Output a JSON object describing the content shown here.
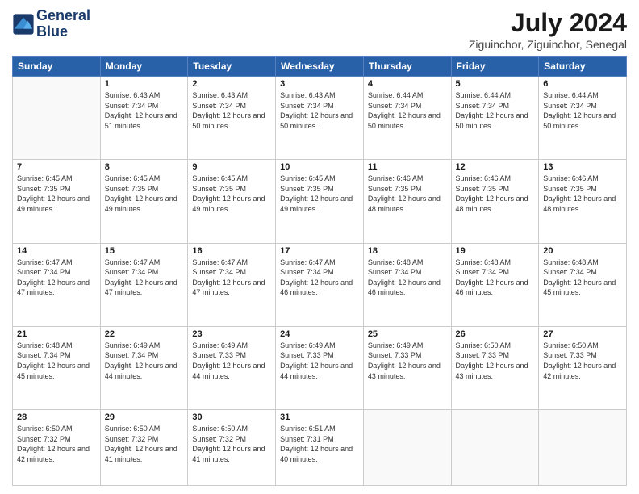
{
  "header": {
    "logo_line1": "General",
    "logo_line2": "Blue",
    "month_title": "July 2024",
    "subtitle": "Ziguinchor, Ziguinchor, Senegal"
  },
  "days_of_week": [
    "Sunday",
    "Monday",
    "Tuesday",
    "Wednesday",
    "Thursday",
    "Friday",
    "Saturday"
  ],
  "weeks": [
    [
      {
        "day": "",
        "sunrise": "",
        "sunset": "",
        "daylight": ""
      },
      {
        "day": "1",
        "sunrise": "Sunrise: 6:43 AM",
        "sunset": "Sunset: 7:34 PM",
        "daylight": "Daylight: 12 hours and 51 minutes."
      },
      {
        "day": "2",
        "sunrise": "Sunrise: 6:43 AM",
        "sunset": "Sunset: 7:34 PM",
        "daylight": "Daylight: 12 hours and 50 minutes."
      },
      {
        "day": "3",
        "sunrise": "Sunrise: 6:43 AM",
        "sunset": "Sunset: 7:34 PM",
        "daylight": "Daylight: 12 hours and 50 minutes."
      },
      {
        "day": "4",
        "sunrise": "Sunrise: 6:44 AM",
        "sunset": "Sunset: 7:34 PM",
        "daylight": "Daylight: 12 hours and 50 minutes."
      },
      {
        "day": "5",
        "sunrise": "Sunrise: 6:44 AM",
        "sunset": "Sunset: 7:34 PM",
        "daylight": "Daylight: 12 hours and 50 minutes."
      },
      {
        "day": "6",
        "sunrise": "Sunrise: 6:44 AM",
        "sunset": "Sunset: 7:34 PM",
        "daylight": "Daylight: 12 hours and 50 minutes."
      }
    ],
    [
      {
        "day": "7",
        "sunrise": "Sunrise: 6:45 AM",
        "sunset": "Sunset: 7:35 PM",
        "daylight": "Daylight: 12 hours and 49 minutes."
      },
      {
        "day": "8",
        "sunrise": "Sunrise: 6:45 AM",
        "sunset": "Sunset: 7:35 PM",
        "daylight": "Daylight: 12 hours and 49 minutes."
      },
      {
        "day": "9",
        "sunrise": "Sunrise: 6:45 AM",
        "sunset": "Sunset: 7:35 PM",
        "daylight": "Daylight: 12 hours and 49 minutes."
      },
      {
        "day": "10",
        "sunrise": "Sunrise: 6:45 AM",
        "sunset": "Sunset: 7:35 PM",
        "daylight": "Daylight: 12 hours and 49 minutes."
      },
      {
        "day": "11",
        "sunrise": "Sunrise: 6:46 AM",
        "sunset": "Sunset: 7:35 PM",
        "daylight": "Daylight: 12 hours and 48 minutes."
      },
      {
        "day": "12",
        "sunrise": "Sunrise: 6:46 AM",
        "sunset": "Sunset: 7:35 PM",
        "daylight": "Daylight: 12 hours and 48 minutes."
      },
      {
        "day": "13",
        "sunrise": "Sunrise: 6:46 AM",
        "sunset": "Sunset: 7:35 PM",
        "daylight": "Daylight: 12 hours and 48 minutes."
      }
    ],
    [
      {
        "day": "14",
        "sunrise": "Sunrise: 6:47 AM",
        "sunset": "Sunset: 7:34 PM",
        "daylight": "Daylight: 12 hours and 47 minutes."
      },
      {
        "day": "15",
        "sunrise": "Sunrise: 6:47 AM",
        "sunset": "Sunset: 7:34 PM",
        "daylight": "Daylight: 12 hours and 47 minutes."
      },
      {
        "day": "16",
        "sunrise": "Sunrise: 6:47 AM",
        "sunset": "Sunset: 7:34 PM",
        "daylight": "Daylight: 12 hours and 47 minutes."
      },
      {
        "day": "17",
        "sunrise": "Sunrise: 6:47 AM",
        "sunset": "Sunset: 7:34 PM",
        "daylight": "Daylight: 12 hours and 46 minutes."
      },
      {
        "day": "18",
        "sunrise": "Sunrise: 6:48 AM",
        "sunset": "Sunset: 7:34 PM",
        "daylight": "Daylight: 12 hours and 46 minutes."
      },
      {
        "day": "19",
        "sunrise": "Sunrise: 6:48 AM",
        "sunset": "Sunset: 7:34 PM",
        "daylight": "Daylight: 12 hours and 46 minutes."
      },
      {
        "day": "20",
        "sunrise": "Sunrise: 6:48 AM",
        "sunset": "Sunset: 7:34 PM",
        "daylight": "Daylight: 12 hours and 45 minutes."
      }
    ],
    [
      {
        "day": "21",
        "sunrise": "Sunrise: 6:48 AM",
        "sunset": "Sunset: 7:34 PM",
        "daylight": "Daylight: 12 hours and 45 minutes."
      },
      {
        "day": "22",
        "sunrise": "Sunrise: 6:49 AM",
        "sunset": "Sunset: 7:34 PM",
        "daylight": "Daylight: 12 hours and 44 minutes."
      },
      {
        "day": "23",
        "sunrise": "Sunrise: 6:49 AM",
        "sunset": "Sunset: 7:33 PM",
        "daylight": "Daylight: 12 hours and 44 minutes."
      },
      {
        "day": "24",
        "sunrise": "Sunrise: 6:49 AM",
        "sunset": "Sunset: 7:33 PM",
        "daylight": "Daylight: 12 hours and 44 minutes."
      },
      {
        "day": "25",
        "sunrise": "Sunrise: 6:49 AM",
        "sunset": "Sunset: 7:33 PM",
        "daylight": "Daylight: 12 hours and 43 minutes."
      },
      {
        "day": "26",
        "sunrise": "Sunrise: 6:50 AM",
        "sunset": "Sunset: 7:33 PM",
        "daylight": "Daylight: 12 hours and 43 minutes."
      },
      {
        "day": "27",
        "sunrise": "Sunrise: 6:50 AM",
        "sunset": "Sunset: 7:33 PM",
        "daylight": "Daylight: 12 hours and 42 minutes."
      }
    ],
    [
      {
        "day": "28",
        "sunrise": "Sunrise: 6:50 AM",
        "sunset": "Sunset: 7:32 PM",
        "daylight": "Daylight: 12 hours and 42 minutes."
      },
      {
        "day": "29",
        "sunrise": "Sunrise: 6:50 AM",
        "sunset": "Sunset: 7:32 PM",
        "daylight": "Daylight: 12 hours and 41 minutes."
      },
      {
        "day": "30",
        "sunrise": "Sunrise: 6:50 AM",
        "sunset": "Sunset: 7:32 PM",
        "daylight": "Daylight: 12 hours and 41 minutes."
      },
      {
        "day": "31",
        "sunrise": "Sunrise: 6:51 AM",
        "sunset": "Sunset: 7:31 PM",
        "daylight": "Daylight: 12 hours and 40 minutes."
      },
      {
        "day": "",
        "sunrise": "",
        "sunset": "",
        "daylight": ""
      },
      {
        "day": "",
        "sunrise": "",
        "sunset": "",
        "daylight": ""
      },
      {
        "day": "",
        "sunrise": "",
        "sunset": "",
        "daylight": ""
      }
    ]
  ]
}
